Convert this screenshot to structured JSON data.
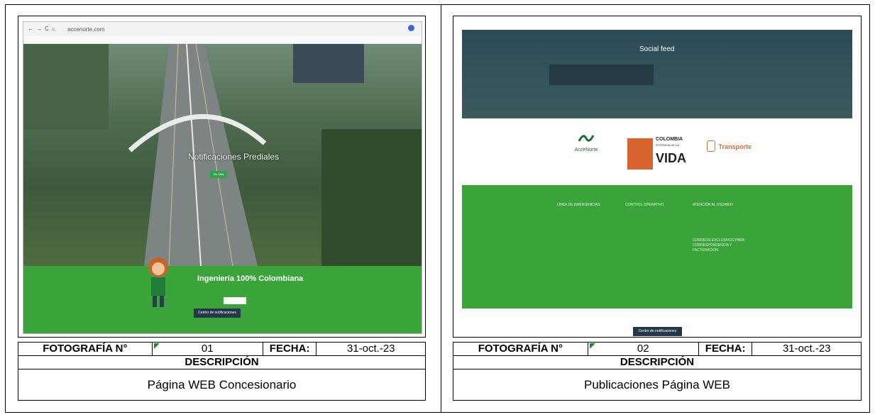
{
  "panels": [
    {
      "photo_label": "FOTOGRAFÍA N°",
      "photo_number": "01",
      "date_label": "FECHA:",
      "date": "31-oct.-23",
      "description_label": "DESCRIPCIÓN",
      "description": "Página WEB Concesionario",
      "screenshot": {
        "url": "accenorte.com",
        "hero_text": "Notificaciones Prediales",
        "hero_button": "Ver Más",
        "banner_title": "Ingeniería 100% Colombiana",
        "notifications_button": "Centro de notificaciones"
      }
    },
    {
      "photo_label": "FOTOGRAFÍA N°",
      "photo_number": "02",
      "date_label": "FECHA:",
      "date": "31-oct.-23",
      "description_label": "DESCRIPCIÓN",
      "description": "Publicaciones Página WEB",
      "screenshot": {
        "social_title": "Social feed",
        "logo_accenorte": "AcceNorte",
        "logo_colombia_1": "COLOMBIA",
        "logo_colombia_2": "POTENCIA DE LA",
        "logo_colombia_3": "VIDA",
        "logo_transporte": "Transporte",
        "col1_title": "LÍNEA DE EMERGENCIAS",
        "col2_title": "CONTROL OPERATIVO",
        "col3_title": "ATENCIÓN AL USUARIO",
        "col3_subtitle": "CORREOS EXCLUSIVOS PARA CORRESPONDENCIA Y FACTURACIÓN",
        "notifications_button": "Centro de notificaciones"
      }
    }
  ],
  "colors": {
    "brand_green": "#3aa43a",
    "dark_header": "#2c4a57"
  }
}
